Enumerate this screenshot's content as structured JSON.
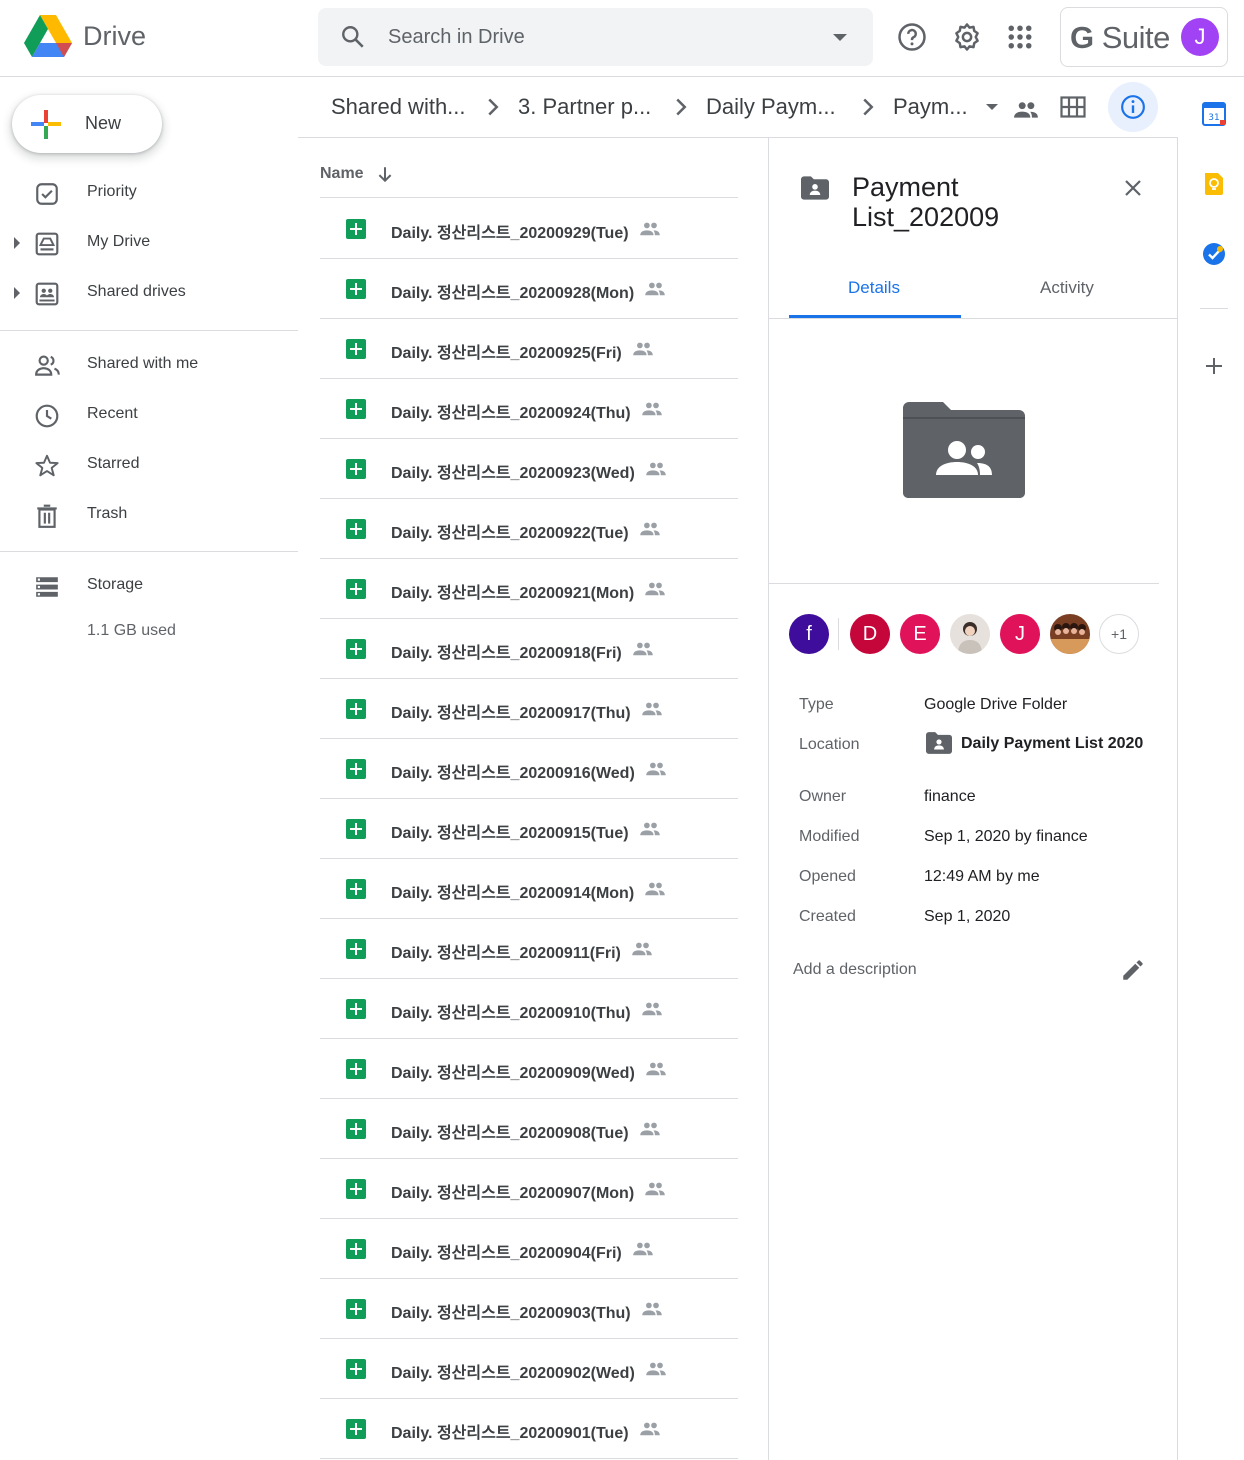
{
  "app": {
    "name": "Drive"
  },
  "search": {
    "placeholder": "Search in Drive"
  },
  "header": {
    "suite_label": "G Suite",
    "account_initial": "J",
    "account_color": "#a142f4"
  },
  "sidebar": {
    "new_label": "New",
    "items": [
      {
        "label": "Priority",
        "icon": "priority-icon"
      },
      {
        "label": "My Drive",
        "icon": "my-drive-icon"
      },
      {
        "label": "Shared drives",
        "icon": "shared-drives-icon"
      },
      {
        "label": "Shared with me",
        "icon": "shared-with-me-icon"
      },
      {
        "label": "Recent",
        "icon": "clock-icon"
      },
      {
        "label": "Starred",
        "icon": "star-icon"
      },
      {
        "label": "Trash",
        "icon": "trash-icon"
      }
    ],
    "storage": {
      "label": "Storage",
      "used": "1.1 GB used"
    }
  },
  "breadcrumb": [
    "Shared with...",
    "3. Partner p...",
    "Daily Paym...",
    "Paym..."
  ],
  "list": {
    "column_name": "Name",
    "files": [
      "Daily. 정산리스트_20200929(Tue)",
      "Daily. 정산리스트_20200928(Mon)",
      "Daily. 정산리스트_20200925(Fri)",
      "Daily. 정산리스트_20200924(Thu)",
      "Daily. 정산리스트_20200923(Wed)",
      "Daily. 정산리스트_20200922(Tue)",
      "Daily. 정산리스트_20200921(Mon)",
      "Daily. 정산리스트_20200918(Fri)",
      "Daily. 정산리스트_20200917(Thu)",
      "Daily. 정산리스트_20200916(Wed)",
      "Daily. 정산리스트_20200915(Tue)",
      "Daily. 정산리스트_20200914(Mon)",
      "Daily. 정산리스트_20200911(Fri)",
      "Daily. 정산리스트_20200910(Thu)",
      "Daily. 정산리스트_20200909(Wed)",
      "Daily. 정산리스트_20200908(Tue)",
      "Daily. 정산리스트_20200907(Mon)",
      "Daily. 정산리스트_20200904(Fri)",
      "Daily. 정산리스트_20200903(Thu)",
      "Daily. 정산리스트_20200902(Wed)",
      "Daily. 정산리스트_20200901(Tue)"
    ]
  },
  "details": {
    "title_line1": "Payment",
    "title_line2": "List_202009",
    "tab_details": "Details",
    "tab_activity": "Activity",
    "people": [
      {
        "initial": "f",
        "color": "#3f0d9c"
      },
      {
        "initial": "D",
        "color": "#c5063a"
      },
      {
        "initial": "E",
        "color": "#e0135a"
      },
      {
        "initial": "",
        "color": "#d9d4cf"
      },
      {
        "initial": "J",
        "color": "#e0135a"
      },
      {
        "initial": "",
        "color": "#8a4b2a"
      }
    ],
    "people_more": "+1",
    "type_label": "Type",
    "type_value": "Google Drive Folder",
    "location_label": "Location",
    "location_value": "Daily Payment List 2020",
    "owner_label": "Owner",
    "owner_value": "finance",
    "modified_label": "Modified",
    "modified_value": "Sep 1, 2020 by finance",
    "opened_label": "Opened",
    "opened_value": "12:49 AM by me",
    "created_label": "Created",
    "created_value": "Sep 1, 2020",
    "description_placeholder": "Add a description"
  },
  "colors": {
    "accent": "#1a73e8",
    "sheets_green": "#0f9d58",
    "folder_gray": "#5f6368"
  }
}
